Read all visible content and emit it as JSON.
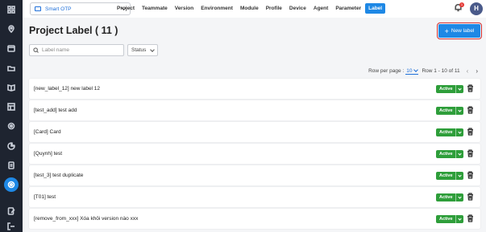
{
  "topbar": {
    "project_name": "Smart OTP",
    "nav": [
      "Project",
      "Teammate",
      "Version",
      "Environment",
      "Module",
      "Profile",
      "Device",
      "Agent",
      "Parameter",
      "Label"
    ],
    "active_nav": "Label",
    "notification_count": "1",
    "avatar_initial": "H"
  },
  "page": {
    "title": "Project Label ( 11 )",
    "new_label_button": "New label",
    "search_placeholder": "Label name",
    "status_filter": "Status"
  },
  "pagination": {
    "rows_per_page_label": "Row per page :",
    "rows_per_page_value": "10",
    "range_text": "Row 1 - 10 of 11"
  },
  "labels": [
    {
      "name": "[new_label_12] new label 12",
      "status": "Active"
    },
    {
      "name": "[test_add] test add",
      "status": "Active"
    },
    {
      "name": "[Card] Card",
      "status": "Active"
    },
    {
      "name": "[Quynh] test",
      "status": "Active"
    },
    {
      "name": "[test_3] test duplicate",
      "status": "Active"
    },
    {
      "name": "[T01] test",
      "status": "Active"
    },
    {
      "name": "[remove_from_xxx] Xóa khỏi version nào xxx",
      "status": "Active"
    }
  ],
  "colors": {
    "accent": "#1e88e5",
    "active_status": "#2e9e3a",
    "sidebar": "#1e2430",
    "highlight_outline": "#d32f2f"
  }
}
